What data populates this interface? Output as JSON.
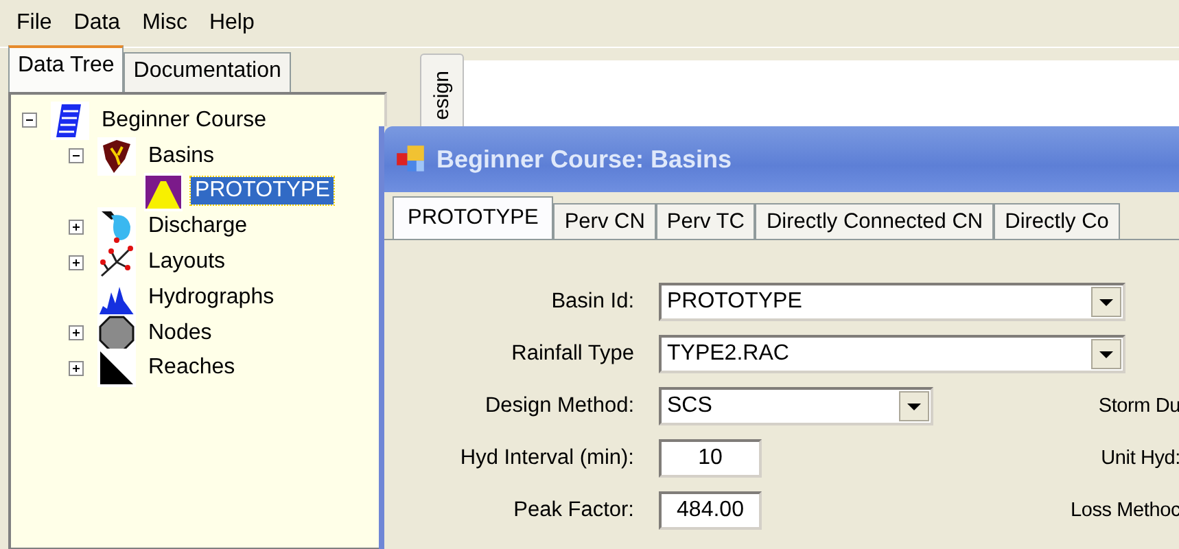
{
  "menu": [
    "File",
    "Data",
    "Misc",
    "Help"
  ],
  "side_tabs": [
    {
      "label": "Data Tree",
      "selected": true
    },
    {
      "label": "Documentation",
      "selected": false
    }
  ],
  "tree": [
    {
      "label": "Beginner Course",
      "kind": "course",
      "expanded": true,
      "selected": false,
      "children": [
        {
          "label": "Basins",
          "kind": "basins",
          "expanded": true,
          "selected": false,
          "children": [
            {
              "label": "PROTOTYPE",
              "kind": "prototype",
              "selected": true
            }
          ]
        },
        {
          "label": "Discharge",
          "kind": "discharge",
          "expanded": false,
          "selected": false
        },
        {
          "label": "Layouts",
          "kind": "layouts",
          "expanded": false,
          "selected": false
        },
        {
          "label": "Hydrographs",
          "kind": "hydrographs",
          "selected": false
        },
        {
          "label": "Nodes",
          "kind": "nodes",
          "expanded": false,
          "selected": false
        },
        {
          "label": "Reaches",
          "kind": "reaches",
          "expanded": false,
          "selected": false
        }
      ]
    }
  ],
  "vertical_tab": "esign",
  "dialog": {
    "title": "Beginner Course: Basins",
    "tabs": [
      {
        "label": "PROTOTYPE",
        "selected": true
      },
      {
        "label": "Perv CN",
        "selected": false
      },
      {
        "label": "Perv TC",
        "selected": false
      },
      {
        "label": "Directly Connected CN",
        "selected": false
      },
      {
        "label": "Directly Co",
        "selected": false
      }
    ],
    "fields": [
      {
        "label": "Basin Id:",
        "value": "PROTOTYPE",
        "kind": "combo-wide"
      },
      {
        "label": "Rainfall Type",
        "value": "TYPE2.RAC",
        "kind": "combo-wide"
      },
      {
        "label": "Design Method:",
        "value": "SCS",
        "kind": "combo",
        "side_label": "Storm Du"
      },
      {
        "label": "Hyd Interval (min):",
        "value": "10",
        "kind": "number",
        "side_label": "Unit Hyd:"
      },
      {
        "label": "Peak Factor:",
        "value": "484.00",
        "kind": "number",
        "side_label": "Loss Methoc"
      }
    ]
  }
}
